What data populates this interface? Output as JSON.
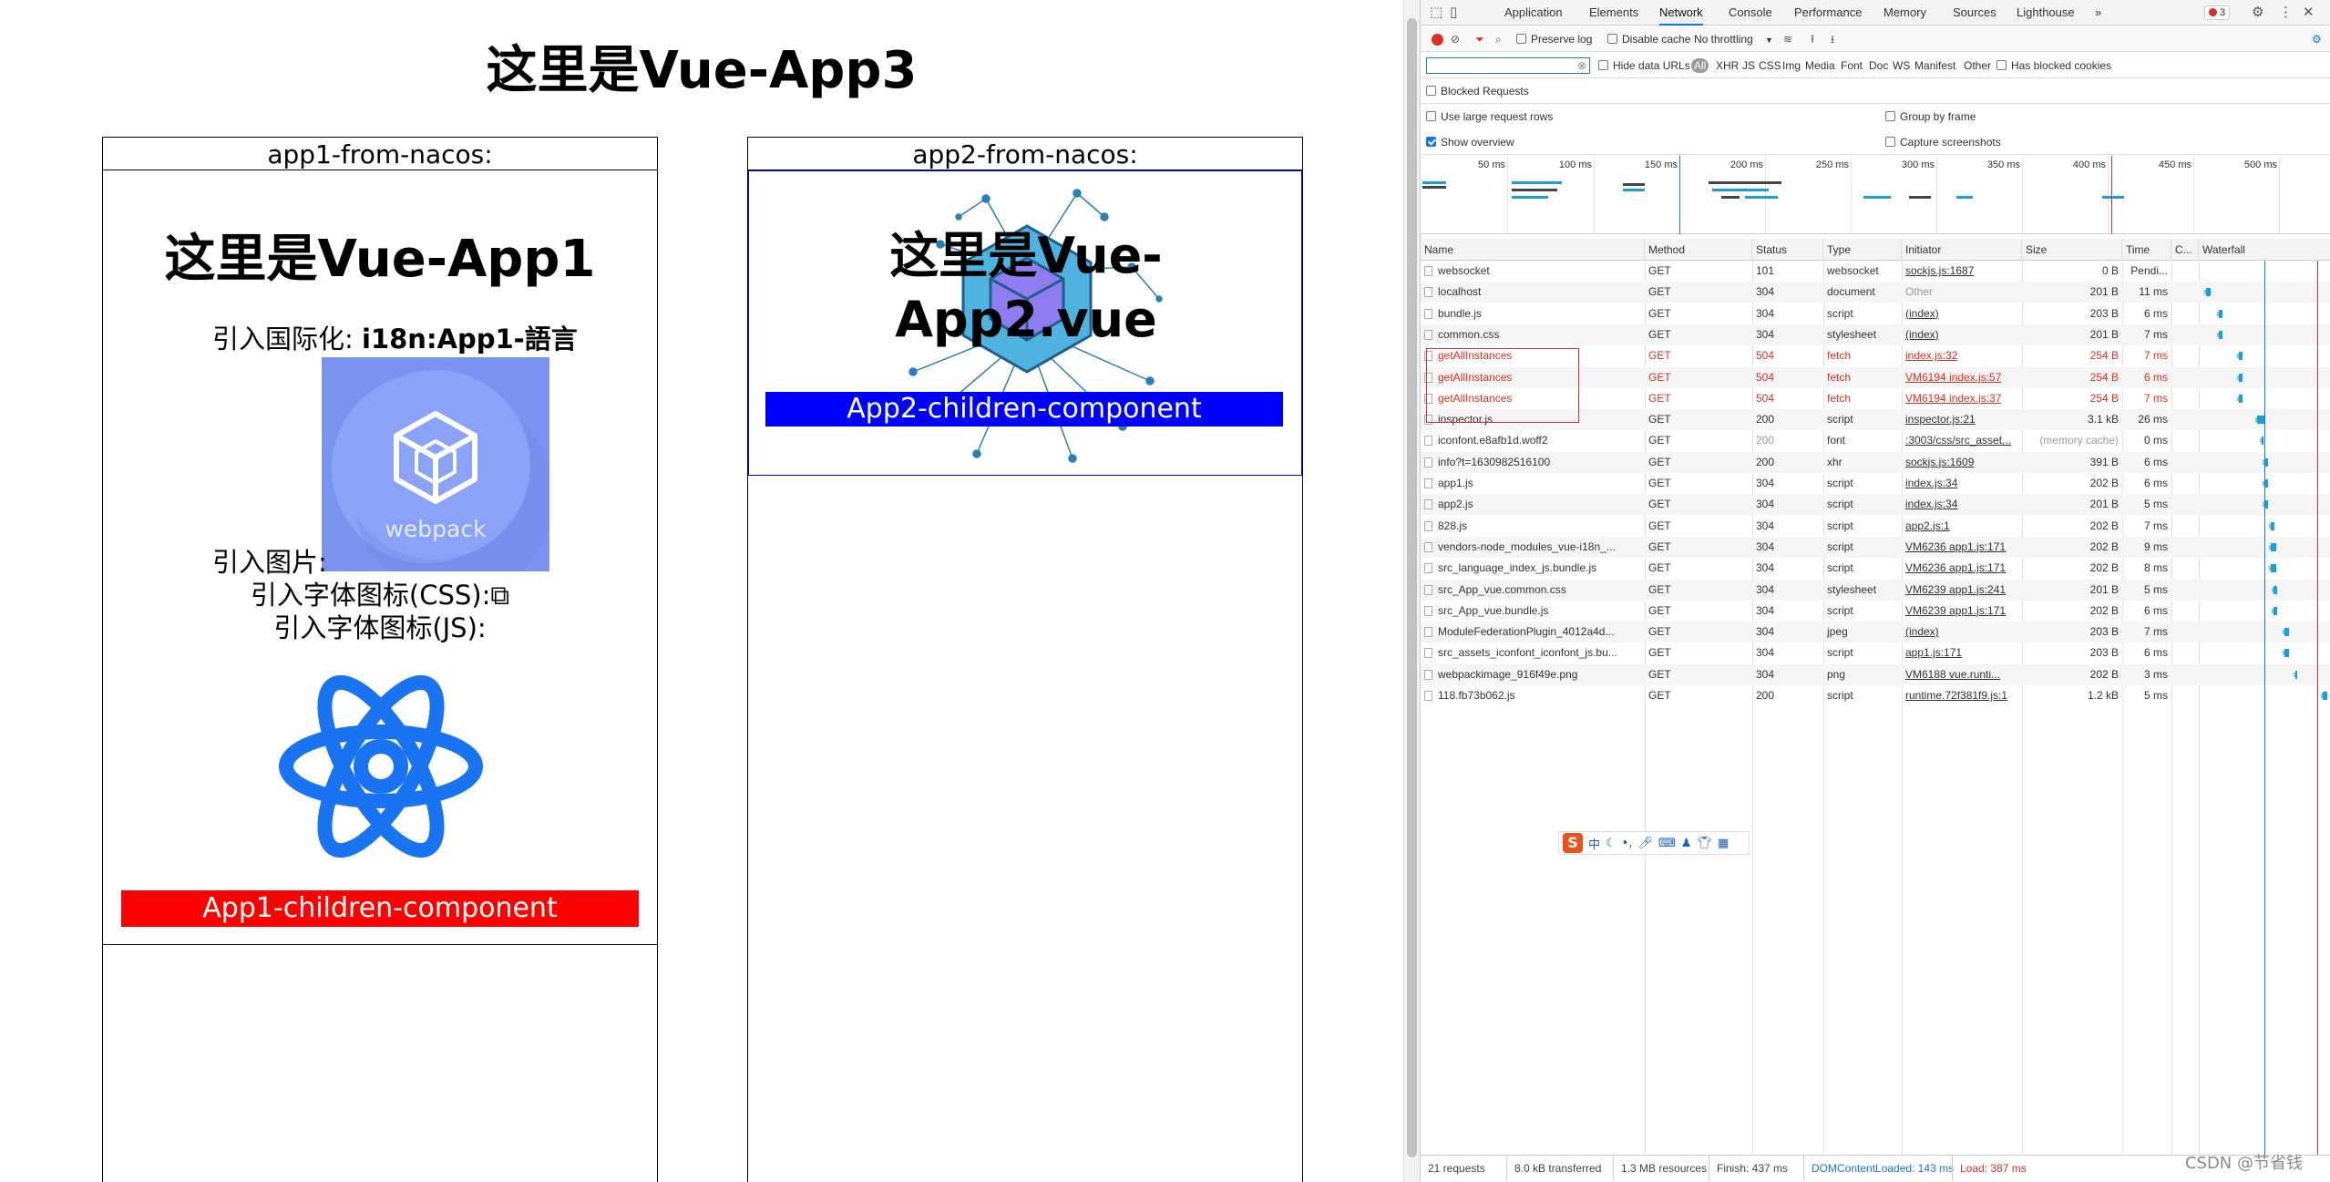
{
  "page": {
    "title": "这里是Vue-App3",
    "app1": {
      "label": "app1-from-nacos:",
      "title": "这里是Vue-App1",
      "i18n_prefix": "引入国际化: ",
      "i18n_value": "i18n:App1-語言",
      "image_label": "引入图片:",
      "webpack_text": "webpack",
      "font_css_label": "引入字体图标(CSS):",
      "font_css_glyph": "⧉",
      "font_js_label": "引入字体图标(JS):",
      "child": "App1-children-component"
    },
    "app2": {
      "label": "app2-from-nacos:",
      "title_line1": "这里是Vue-",
      "title_line2": "App2.vue",
      "child": "App2-children-component"
    },
    "ime": {
      "logo": "S",
      "mode": "中"
    }
  },
  "devtools": {
    "tabs": [
      "Application",
      "Elements",
      "Network",
      "Console",
      "Performance",
      "Memory",
      "Sources",
      "Lighthouse"
    ],
    "active_tab": "Network",
    "more_tabs": "»",
    "error_count": "3",
    "toolbar": {
      "preserve_log": "Preserve log",
      "disable_cache": "Disable cache",
      "throttling": "No throttling",
      "throttle_arrow": "▼"
    },
    "filter": {
      "placeholder": "",
      "hide_data_urls": "Hide data URLs",
      "types": [
        "All",
        "XHR",
        "JS",
        "CSS",
        "Img",
        "Media",
        "Font",
        "Doc",
        "WS",
        "Manifest",
        "Other"
      ],
      "active_type": "All",
      "has_blocked_cookies": "Has blocked cookies"
    },
    "options": {
      "blocked_requests": "Blocked Requests",
      "large_rows": "Use large request rows",
      "group_by_frame": "Group by frame",
      "show_overview": "Show overview",
      "capture_screenshots": "Capture screenshots"
    },
    "overview_ticks": [
      "50 ms",
      "100 ms",
      "150 ms",
      "200 ms",
      "250 ms",
      "300 ms",
      "350 ms",
      "400 ms",
      "450 ms",
      "500 ms"
    ],
    "columns": [
      "Name",
      "Method",
      "Status",
      "Type",
      "Initiator",
      "Size",
      "Time",
      "C...",
      "Waterfall"
    ],
    "rows": [
      {
        "name": "websocket",
        "method": "GET",
        "status": "101",
        "type": "websocket",
        "initiator": "sockjs.js:1687",
        "size": "0 B",
        "time": "Pendi...",
        "wf_start": 0,
        "wf_len": 0
      },
      {
        "name": "localhost",
        "method": "GET",
        "status": "304",
        "type": "document",
        "initiator": "Other",
        "size": "201 B",
        "time": "11 ms",
        "wf_start": 4,
        "wf_len": 4
      },
      {
        "name": "bundle.js",
        "method": "GET",
        "status": "304",
        "type": "script",
        "initiator": "(index)",
        "size": "203 B",
        "time": "6 ms",
        "wf_start": 14,
        "wf_len": 3
      },
      {
        "name": "common.css",
        "method": "GET",
        "status": "304",
        "type": "stylesheet",
        "initiator": "(index)",
        "size": "201 B",
        "time": "7 ms",
        "wf_start": 14,
        "wf_len": 3
      },
      {
        "name": "getAllInstances",
        "method": "GET",
        "status": "504",
        "type": "fetch",
        "initiator": "index.js:32",
        "size": "254 B",
        "time": "7 ms",
        "failed": true,
        "wf_start": 30,
        "wf_len": 3
      },
      {
        "name": "getAllInstances",
        "method": "GET",
        "status": "504",
        "type": "fetch",
        "initiator": "VM6194 index.js:57",
        "size": "254 B",
        "time": "6 ms",
        "failed": true,
        "wf_start": 30,
        "wf_len": 3
      },
      {
        "name": "getAllInstances",
        "method": "GET",
        "status": "504",
        "type": "fetch",
        "initiator": "VM6194 index.js:37",
        "size": "254 B",
        "time": "7 ms",
        "failed": true,
        "wf_start": 30,
        "wf_len": 3
      },
      {
        "name": "inspector.js",
        "method": "GET",
        "status": "200",
        "type": "script",
        "initiator": "inspector.js:21",
        "size": "3.1 kB",
        "time": "26 ms",
        "wf_start": 44,
        "wf_len": 6
      },
      {
        "name": "iconfont.e8afb1d.woff2",
        "method": "GET",
        "status": "200",
        "type": "font",
        "initiator": ":3003/css/src_asset...",
        "size": "(memory cache)",
        "time": "0 ms",
        "muted": true,
        "wf_start": 48,
        "wf_len": 1
      },
      {
        "name": "info?t=1630982516100",
        "method": "GET",
        "status": "200",
        "type": "xhr",
        "initiator": "sockjs.js:1609",
        "size": "391 B",
        "time": "6 ms",
        "wf_start": 50,
        "wf_len": 3
      },
      {
        "name": "app1.js",
        "method": "GET",
        "status": "304",
        "type": "script",
        "initiator": "index.js:34",
        "size": "202 B",
        "time": "6 ms",
        "wf_start": 50,
        "wf_len": 3
      },
      {
        "name": "app2.js",
        "method": "GET",
        "status": "304",
        "type": "script",
        "initiator": "index.js:34",
        "size": "201 B",
        "time": "5 ms",
        "wf_start": 50,
        "wf_len": 3
      },
      {
        "name": "828.js",
        "method": "GET",
        "status": "304",
        "type": "script",
        "initiator": "app2.js:1",
        "size": "202 B",
        "time": "7 ms",
        "wf_start": 55,
        "wf_len": 3
      },
      {
        "name": "vendors-node_modules_vue-i18n_...",
        "method": "GET",
        "status": "304",
        "type": "script",
        "initiator": "VM6236 app1.js:171",
        "size": "202 B",
        "time": "9 ms",
        "wf_start": 55,
        "wf_len": 4
      },
      {
        "name": "src_language_index_js.bundle.js",
        "method": "GET",
        "status": "304",
        "type": "script",
        "initiator": "VM6236 app1.js:171",
        "size": "202 B",
        "time": "8 ms",
        "wf_start": 55,
        "wf_len": 4
      },
      {
        "name": "src_App_vue.common.css",
        "method": "GET",
        "status": "304",
        "type": "stylesheet",
        "initiator": "VM6239 app1.js:241",
        "size": "201 B",
        "time": "5 ms",
        "wf_start": 57,
        "wf_len": 3
      },
      {
        "name": "src_App_vue.bundle.js",
        "method": "GET",
        "status": "304",
        "type": "script",
        "initiator": "VM6239 app1.js:171",
        "size": "202 B",
        "time": "6 ms",
        "wf_start": 57,
        "wf_len": 3
      },
      {
        "name": "ModuleFederationPlugin_4012a4d...",
        "method": "GET",
        "status": "304",
        "type": "jpeg",
        "initiator": "(index)",
        "size": "203 B",
        "time": "7 ms",
        "wf_start": 66,
        "wf_len": 3
      },
      {
        "name": "src_assets_iconfont_iconfont_js.bu...",
        "method": "GET",
        "status": "304",
        "type": "script",
        "initiator": "app1.js:171",
        "size": "203 B",
        "time": "6 ms",
        "wf_start": 66,
        "wf_len": 3
      },
      {
        "name": "webpackimage_916f49e.png",
        "method": "GET",
        "status": "304",
        "type": "png",
        "initiator": "VM6188 vue.runti...",
        "size": "202 B",
        "time": "3 ms",
        "wf_start": 74,
        "wf_len": 2
      },
      {
        "name": "118.fb73b062.js",
        "method": "GET",
        "status": "200",
        "type": "script",
        "initiator": "runtime.72f381f9.js:1",
        "size": "1.2 kB",
        "time": "5 ms",
        "wf_start": 96,
        "wf_len": 3
      }
    ],
    "status_bar": {
      "requests": "21 requests",
      "transferred": "8.0 kB transferred",
      "resources": "1.3 MB resources",
      "finish": "Finish: 437 ms",
      "dom_loaded": "DOMContentLoaded: 143 ms",
      "load": "Load: 387 ms"
    },
    "colors": {
      "accent": "#1a73e8",
      "error": "#d93025",
      "bar": "#1a9fd9"
    }
  },
  "watermark": "CSDN @节省钱"
}
